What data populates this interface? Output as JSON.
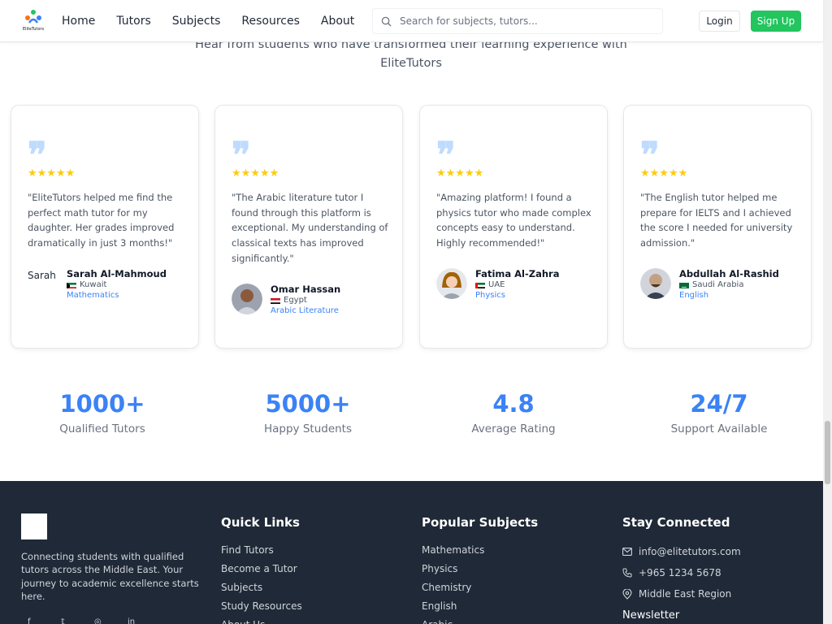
{
  "header": {
    "logo_text": "EliteTutors",
    "nav": [
      "Home",
      "Tutors",
      "Subjects",
      "Resources",
      "About"
    ],
    "search_placeholder": "Search for subjects, tutors...",
    "login_label": "Login",
    "signup_label": "Sign Up"
  },
  "testimonials": {
    "subtitle": "Hear from students who have transformed their learning experience with EliteTutors",
    "cards": [
      {
        "rating": "★★★★★",
        "text": "\"EliteTutors helped me find the perfect math tutor for my daughter. Her grades improved dramatically in just 3 months!\"",
        "name": "Sarah Al-Mahmoud",
        "avatar_alt": "Sarah",
        "country": "Kuwait",
        "subject": "Mathematics"
      },
      {
        "rating": "★★★★★",
        "text": "\"The Arabic literature tutor I found through this platform is exceptional. My understanding of classical texts has improved significantly.\"",
        "name": "Omar Hassan",
        "country": "Egypt",
        "subject": "Arabic Literature"
      },
      {
        "rating": "★★★★★",
        "text": "\"Amazing platform! I found a physics tutor who made complex concepts easy to understand. Highly recommended!\"",
        "name": "Fatima Al-Zahra",
        "country": "UAE",
        "subject": "Physics"
      },
      {
        "rating": "★★★★★",
        "text": "\"The English tutor helped me prepare for IELTS and I achieved the score I needed for university admission.\"",
        "name": "Abdullah Al-Rashid",
        "country": "Saudi Arabia",
        "subject": "English"
      }
    ]
  },
  "stats": [
    {
      "value": "1000+",
      "label": "Qualified Tutors"
    },
    {
      "value": "5000+",
      "label": "Happy Students"
    },
    {
      "value": "4.8",
      "label": "Average Rating"
    },
    {
      "value": "24/7",
      "label": "Support Available"
    }
  ],
  "footer": {
    "description": "Connecting students with qualified tutors across the Middle East. Your journey to academic excellence starts here.",
    "quick_links_title": "Quick Links",
    "quick_links": [
      "Find Tutors",
      "Become a Tutor",
      "Subjects",
      "Study Resources",
      "About Us"
    ],
    "subjects_title": "Popular Subjects",
    "subjects": [
      "Mathematics",
      "Physics",
      "Chemistry",
      "English",
      "Arabic"
    ],
    "connect_title": "Stay Connected",
    "email": "info@elitetutors.com",
    "phone": "+965 1234 5678",
    "location": "Middle East Region",
    "newsletter": "Newsletter"
  },
  "colors": {
    "accent": "#3b82f6",
    "signup": "#22c55e",
    "star": "#facc15",
    "footer_bg": "#1f2937"
  }
}
